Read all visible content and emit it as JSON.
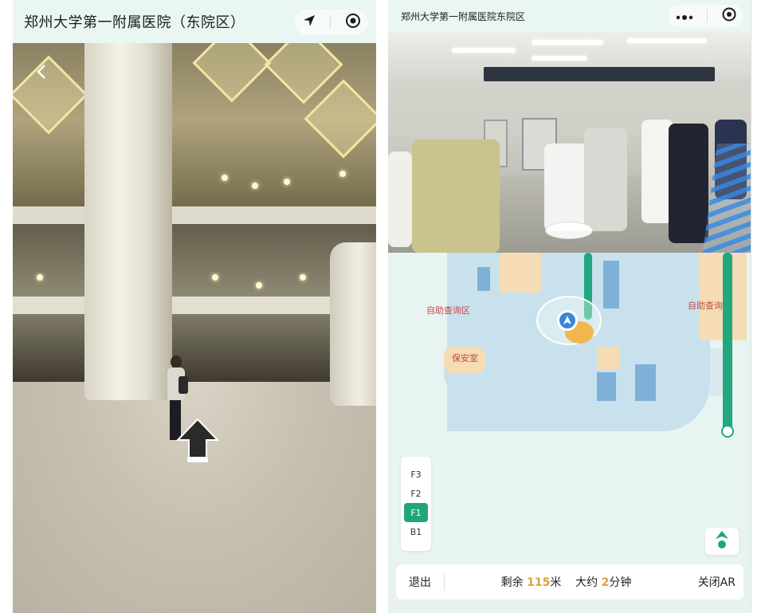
{
  "left": {
    "title": "郑州大学第一附属医院（东院区）",
    "icons": {
      "location": "navigation-arrow-icon",
      "record": "record-target-icon",
      "back": "chevron-left-icon",
      "forward": "forward-arrow-icon"
    }
  },
  "right": {
    "title": "郑州大学第一附属医院东院区",
    "icons": {
      "more": "more-dots-icon",
      "record": "record-target-icon",
      "locate": "locate-me-icon",
      "user_pos": "user-position-arrow-icon"
    },
    "map": {
      "labels": [
        "自助查询区",
        "保安室",
        "自助查询区"
      ],
      "floors": [
        "F3",
        "F2",
        "F1",
        "B1"
      ],
      "active_floor": "F1",
      "route_color": "#22a87e"
    },
    "bottom": {
      "exit": "退出",
      "remaining_label": "剩余",
      "remaining_value": "115",
      "remaining_unit": "米",
      "approx_label": "大约",
      "approx_value": "2",
      "approx_unit": "分钟",
      "close_ar": "关闭AR"
    }
  },
  "colors": {
    "accent": "#1fa57c",
    "highlight_number": "#d9a43a",
    "topbar": "#eaf6f2"
  }
}
